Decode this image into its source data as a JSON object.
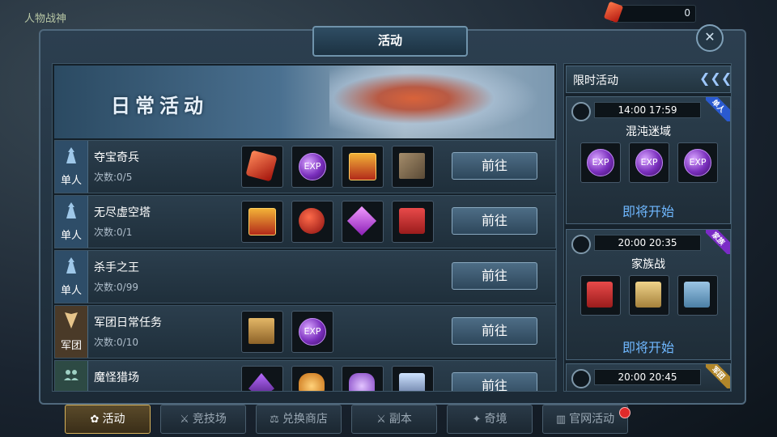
{
  "top_label": "人物战神",
  "currency": {
    "value": "0",
    "icon": "red-gem-icon"
  },
  "window": {
    "title": "活动",
    "close_icon": "crossed-swords-close-icon"
  },
  "banner": {
    "title": "日常活动"
  },
  "activities": [
    {
      "type": "单人",
      "name": "夺宝奇兵",
      "count": "次数:0/5",
      "button": "前往",
      "items": [
        "red-gem",
        "exp-orb",
        "chest",
        "stone"
      ],
      "exp_label": "EXP"
    },
    {
      "type": "单人",
      "name": "无尽虚空塔",
      "count": "次数:0/1",
      "button": "前往",
      "items": [
        "chest",
        "red-bag",
        "purple-gem",
        "gift-red"
      ]
    },
    {
      "type": "单人",
      "name": "杀手之王",
      "count": "次数:0/99",
      "button": "前往",
      "items": []
    },
    {
      "type": "军团",
      "name": "军团日常任务",
      "count": "次数:0/10",
      "button": "前往",
      "items": [
        "crate",
        "exp-orb"
      ],
      "exp_label": "EXP"
    },
    {
      "type": "",
      "name": "魔怪猎场",
      "count": "",
      "button": "前往",
      "items": [
        "purple-shard",
        "amber",
        "violet",
        "ice"
      ]
    }
  ],
  "limited": {
    "header": "限时活动",
    "collapse_glyph": "《《《",
    "events": [
      {
        "time": "14:00  17:59",
        "name": "混沌迷域",
        "status": "即将开始",
        "tag": "单人",
        "items": [
          "exp-orb",
          "exp-orb",
          "exp-orb"
        ],
        "exp_label": "EXP"
      },
      {
        "time": "20:00  20:35",
        "name": "家族战",
        "status": "即将开始",
        "tag": "家族",
        "items": [
          "gift-red",
          "gift-gold",
          "gift-blue"
        ]
      },
      {
        "time": "20:00  20:45",
        "tag": "军团"
      }
    ]
  },
  "tabs": [
    {
      "label": "活动",
      "icon": "flower-icon",
      "active": true
    },
    {
      "label": "竞技场",
      "icon": "swords-icon"
    },
    {
      "label": "兑换商店",
      "icon": "scales-icon"
    },
    {
      "label": "副本",
      "icon": "swords-icon"
    },
    {
      "label": "奇境",
      "icon": "wing-icon"
    },
    {
      "label": "官网活动",
      "icon": "book-icon",
      "notification": true
    }
  ]
}
